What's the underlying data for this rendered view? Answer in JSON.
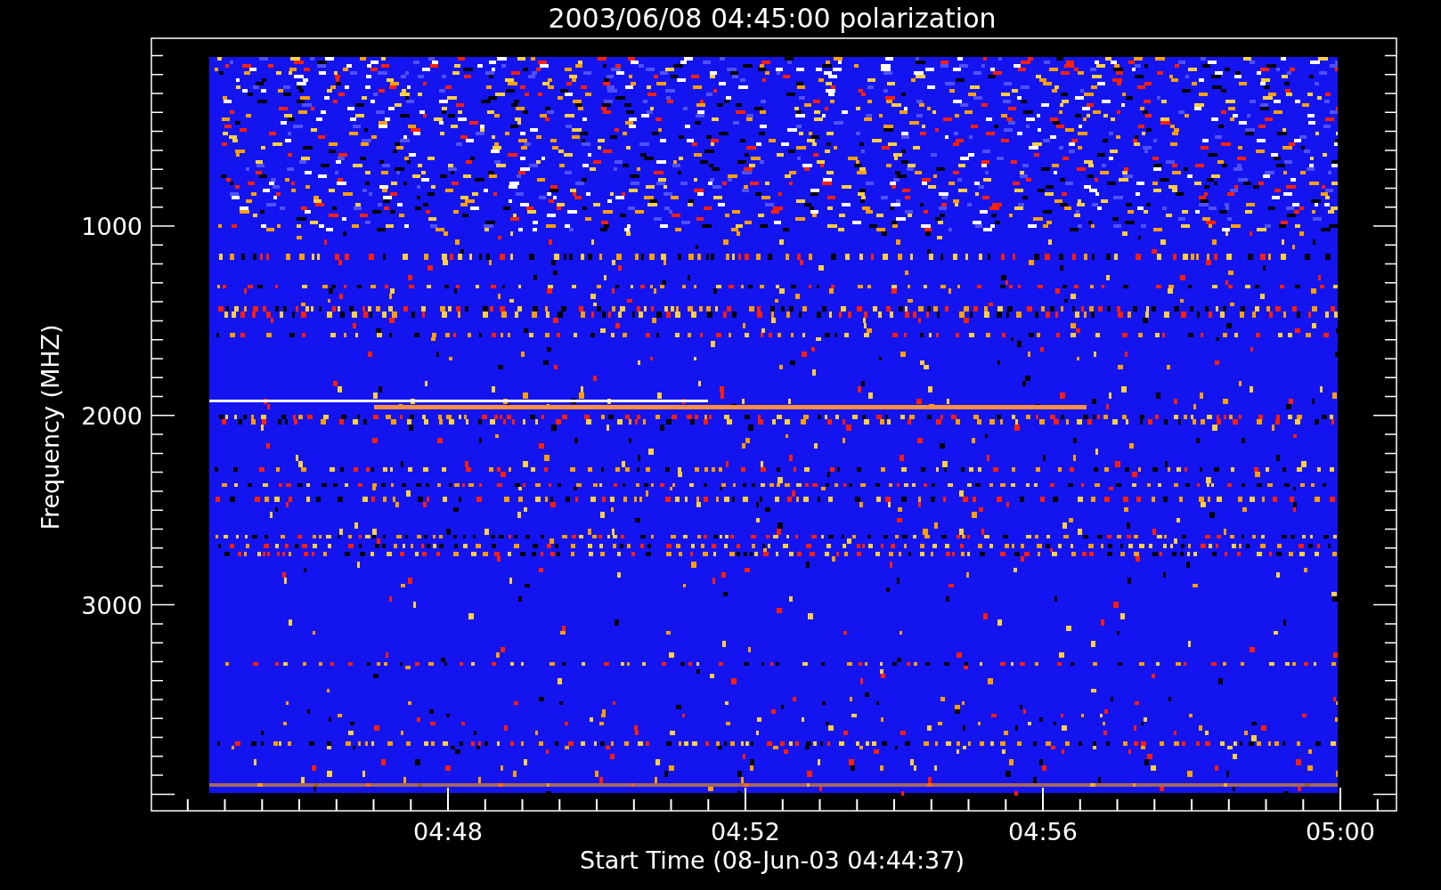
{
  "plot": {
    "title": "2003/06/08 04:45:00 polarization",
    "ylabel": "Frequency (MHZ)",
    "xlabel": "Start Time (08-Jun-03 04:44:37)",
    "yticks": [
      "1000",
      "2000",
      "3000"
    ],
    "xticks": [
      "04:48",
      "04:52",
      "04:56",
      "05:00"
    ]
  }
}
